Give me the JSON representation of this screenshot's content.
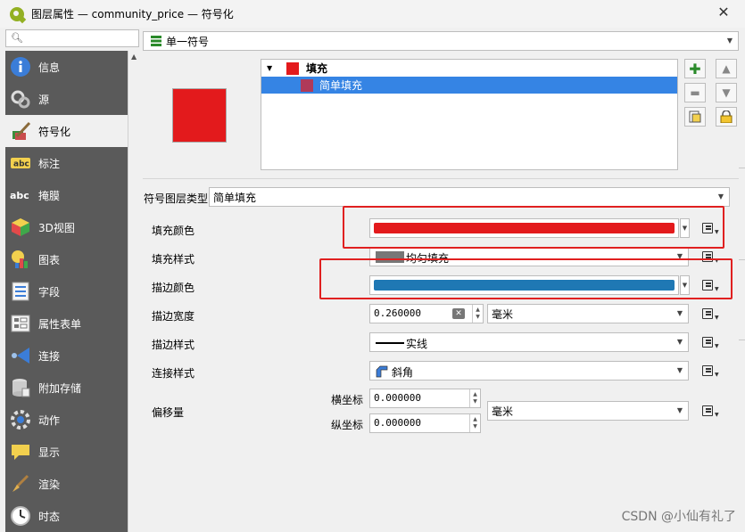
{
  "window": {
    "title": "图层属性 — community_price — 符号化",
    "close_label": "✕"
  },
  "search": {
    "placeholder": ""
  },
  "sidebar": {
    "items": [
      {
        "label": "信息",
        "icon": "info-icon"
      },
      {
        "label": "源",
        "icon": "source-icon"
      },
      {
        "label": "符号化",
        "icon": "symbology-icon"
      },
      {
        "label": "标注",
        "icon": "labels-icon"
      },
      {
        "label": "掩膜",
        "icon": "mask-icon"
      },
      {
        "label": "3D视图",
        "icon": "3d-view-icon"
      },
      {
        "label": "图表",
        "icon": "diagram-icon"
      },
      {
        "label": "字段",
        "icon": "fields-icon"
      },
      {
        "label": "属性表单",
        "icon": "attribute-form-icon"
      },
      {
        "label": "连接",
        "icon": "joins-icon"
      },
      {
        "label": "附加存储",
        "icon": "auxiliary-storage-icon"
      },
      {
        "label": "动作",
        "icon": "actions-icon"
      },
      {
        "label": "显示",
        "icon": "display-icon"
      },
      {
        "label": "渲染",
        "icon": "rendering-icon"
      },
      {
        "label": "时态",
        "icon": "temporal-icon"
      }
    ],
    "active_index": 2
  },
  "renderer": {
    "type_label": "单一符号"
  },
  "symbol_tree": {
    "root_label": "填充",
    "child_label": "简单填充",
    "root_color": "#e31a1c",
    "child_color": "#b03a59"
  },
  "symbol_layer_type": {
    "label": "符号图层类型",
    "value": "简单填充"
  },
  "properties": {
    "fill_color": {
      "label": "填充颜色",
      "color": "#e31a1c"
    },
    "fill_style": {
      "label": "填充样式",
      "value": "均匀填充"
    },
    "stroke_color": {
      "label": "描边颜色",
      "color": "#1f78b4"
    },
    "stroke_width": {
      "label": "描边宽度",
      "value": "0.260000",
      "unit": "毫米"
    },
    "stroke_style": {
      "label": "描边样式",
      "value": "实线"
    },
    "join_style": {
      "label": "连接样式",
      "value": "斜角"
    },
    "offset": {
      "label": "偏移量",
      "x_label": "横坐标",
      "x_value": "0.000000",
      "y_label": "纵坐标",
      "y_value": "0.000000",
      "unit": "毫米"
    }
  },
  "watermark": "CSDN @小仙有礼了",
  "colors": {
    "highlight_box": "#e02020",
    "selection": "#3584e4",
    "sidebar_bg": "#5a5a5a"
  }
}
